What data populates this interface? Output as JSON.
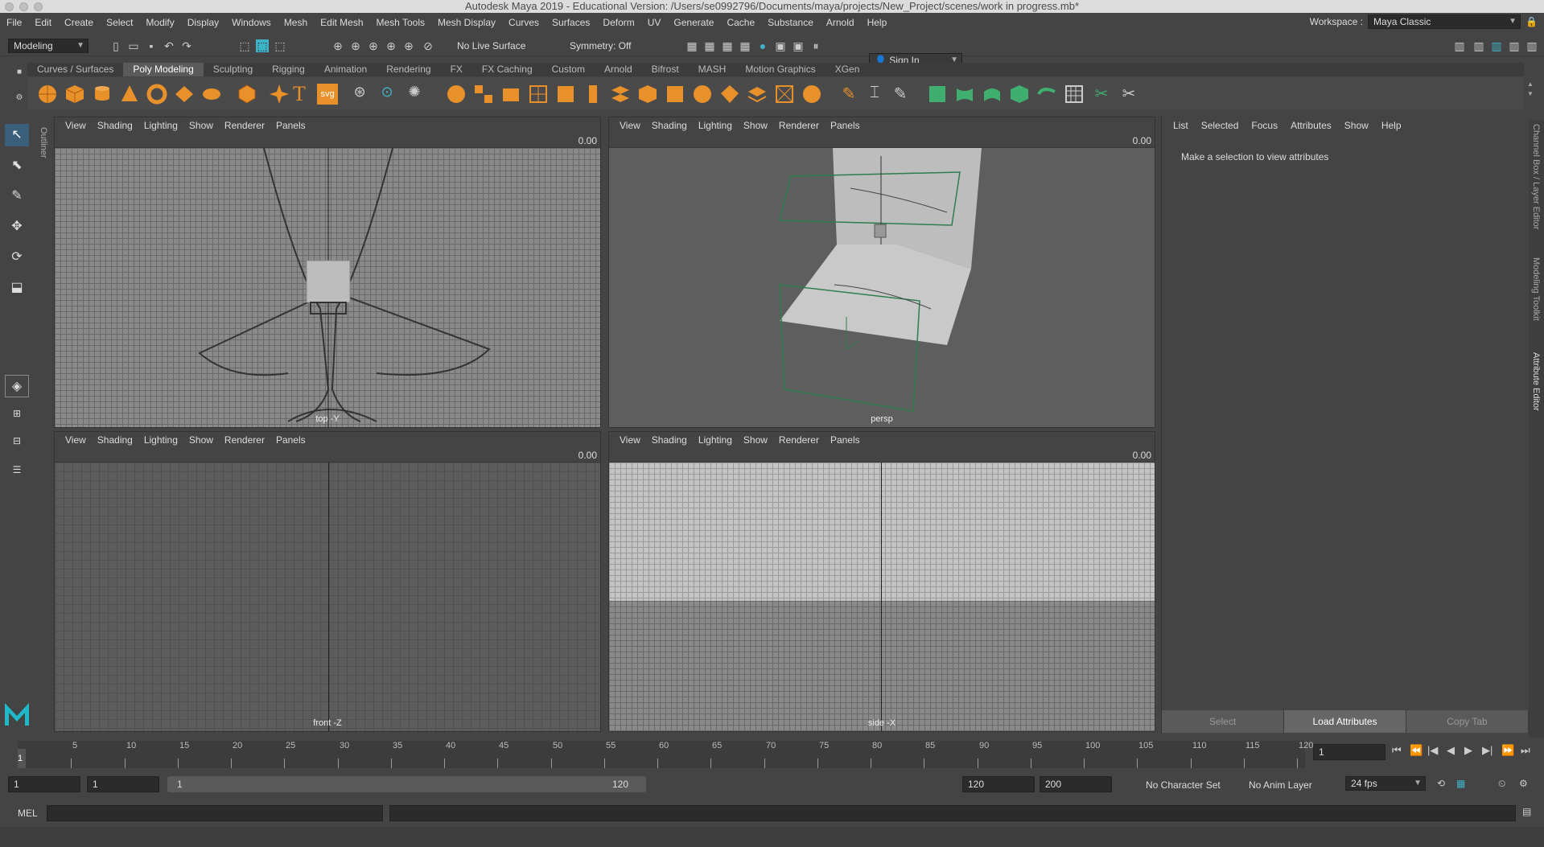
{
  "title": "Autodesk Maya 2019 - Educational Version: /Users/se0992796/Documents/maya/projects/New_Project/scenes/work in progress.mb*",
  "menubar": [
    "File",
    "Edit",
    "Create",
    "Select",
    "Modify",
    "Display",
    "Windows",
    "Mesh",
    "Edit Mesh",
    "Mesh Tools",
    "Mesh Display",
    "Curves",
    "Surfaces",
    "Deform",
    "UV",
    "Generate",
    "Cache",
    "Substance",
    "Arnold",
    "Help"
  ],
  "workspace": {
    "label": "Workspace :",
    "value": "Maya Classic"
  },
  "statusline": {
    "mode": "Modeling",
    "live_surface": "No Live Surface",
    "symmetry": "Symmetry: Off",
    "sign_in": "Sign In"
  },
  "shelf_tabs": [
    "Curves / Surfaces",
    "Poly Modeling",
    "Sculpting",
    "Rigging",
    "Animation",
    "Rendering",
    "FX",
    "FX Caching",
    "Custom",
    "Arnold",
    "Bifrost",
    "MASH",
    "Motion Graphics",
    "XGen"
  ],
  "shelf_active": "Poly Modeling",
  "toolbox": {
    "outliner": "Outliner"
  },
  "viewport_menu": [
    "View",
    "Shading",
    "Lighting",
    "Show",
    "Renderer",
    "Panels"
  ],
  "viewports": {
    "top": {
      "label": "top -Y",
      "value": "0.00"
    },
    "persp": {
      "label": "persp",
      "value": "0.00"
    },
    "front": {
      "label": "front -Z",
      "value": "0.00"
    },
    "side": {
      "label": "side -X",
      "value": "0.00"
    }
  },
  "attribute_editor": {
    "menu": [
      "List",
      "Selected",
      "Focus",
      "Attributes",
      "Show",
      "Help"
    ],
    "message": "Make a selection to view attributes",
    "buttons": [
      "Select",
      "Load Attributes",
      "Copy Tab"
    ]
  },
  "right_tabs": [
    "Channel Box / Layer Editor",
    "Modeling Toolkit",
    "Attribute Editor"
  ],
  "timeline": {
    "ticks": [
      5,
      10,
      15,
      20,
      25,
      30,
      35,
      40,
      45,
      50,
      55,
      60,
      65,
      70,
      75,
      80,
      85,
      90,
      95,
      100,
      105,
      110,
      115,
      120
    ],
    "current_frame_marker": "1",
    "current_frame": "1"
  },
  "range": {
    "start": "1",
    "playback_start": "1",
    "slider_start": "1",
    "slider_end": "120",
    "playback_end": "120",
    "end": "200",
    "character_set": "No Character Set",
    "anim_layer": "No Anim Layer",
    "fps": "24 fps"
  },
  "cmdline": {
    "label": "MEL"
  },
  "colors": {
    "accent": "#3fb3c7",
    "shelf_orange": "#e8912b",
    "shelf_green": "#3fae6f",
    "maya_logo": "#1fb8c9"
  }
}
